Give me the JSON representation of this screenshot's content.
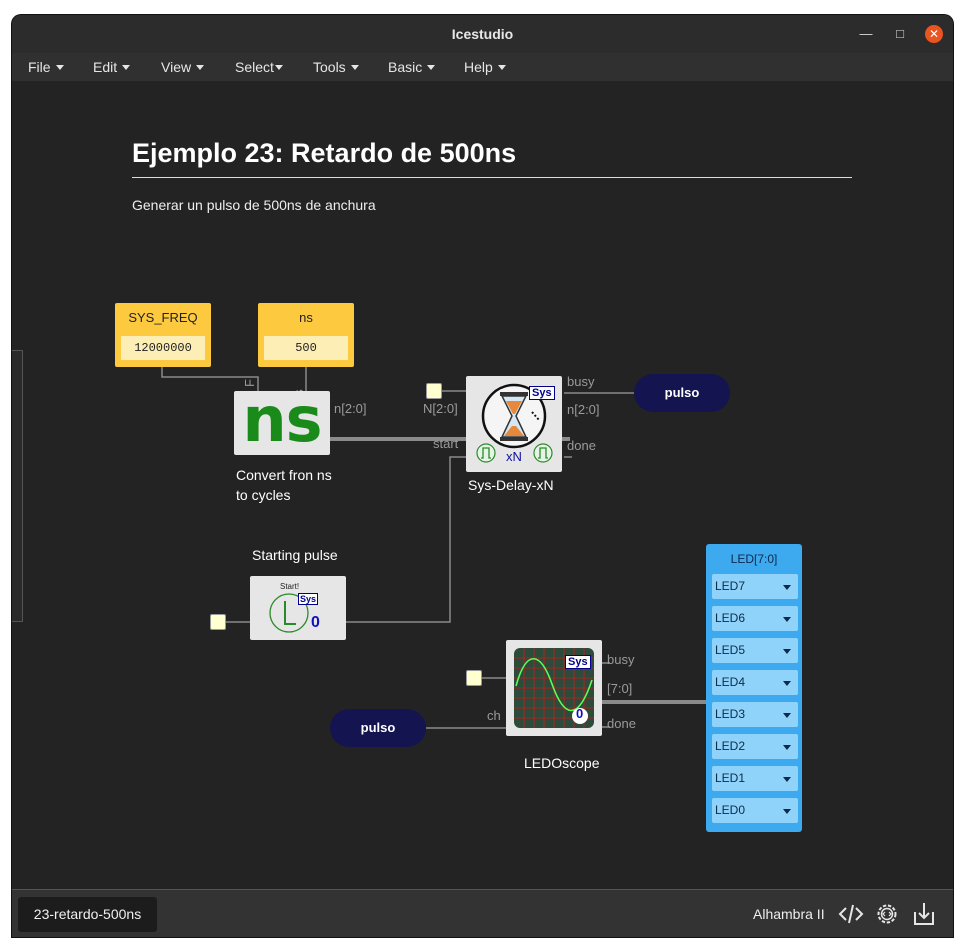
{
  "window": {
    "title": "Icestudio"
  },
  "menu": [
    {
      "label": "File"
    },
    {
      "label": "Edit"
    },
    {
      "label": "View"
    },
    {
      "label": "Select"
    },
    {
      "label": "Tools"
    },
    {
      "label": "Basic"
    },
    {
      "label": "Help"
    }
  ],
  "note": {
    "title": "Ejemplo 23: Retardo de 500ns",
    "text": "Generar un pulso de 500ns de anchura"
  },
  "constants": {
    "sys_freq": {
      "label": "SYS_FREQ",
      "value": "12000000"
    },
    "ns": {
      "label": "ns",
      "value": "500"
    }
  },
  "blocks": {
    "convert": {
      "icon_text": "ns",
      "label_line1": "Convert fron ns",
      "label_line2": "to cycles",
      "port_f": "F",
      "port_ns": "ns",
      "port_out": "n[2:0]"
    },
    "delay": {
      "label": "Sys-Delay-xN",
      "badge": "Sys",
      "xn": "xN",
      "port_in": "N[2:0]",
      "port_start": "start",
      "port_busy": "busy",
      "port_out": "n[2:0]",
      "port_done": "done"
    },
    "start": {
      "label": "Starting pulse",
      "inner_label": "Start!",
      "badge": "Sys",
      "digit": "0"
    },
    "scope": {
      "label": "LEDOscope",
      "badge": "Sys",
      "digit": "0",
      "port_ch": "ch",
      "port_busy": "busy",
      "port_out": "[7:0]",
      "port_done": "done"
    }
  },
  "pulses": {
    "top": "pulso",
    "bottom": "pulso"
  },
  "leds": {
    "header": "LED[7:0]",
    "items": [
      "LED7",
      "LED6",
      "LED5",
      "LED4",
      "LED3",
      "LED2",
      "LED1",
      "LED0"
    ]
  },
  "status": {
    "project": "23-retardo-500ns",
    "board": "Alhambra II"
  },
  "colors": {
    "accent_close": "#e95420",
    "constant": "#fdc93f",
    "led_block": "#3daaf0",
    "pulse": "#141450",
    "ns_green": "#1a8a1a"
  }
}
